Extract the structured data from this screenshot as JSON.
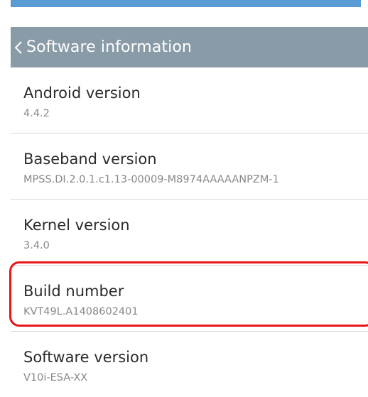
{
  "header": {
    "title": "Software information"
  },
  "items": [
    {
      "label": "Android version",
      "value": "4.4.2"
    },
    {
      "label": "Baseband version",
      "value": "MPSS.DI.2.0.1.c1.13-00009-M8974AAAAANPZM-1"
    },
    {
      "label": "Kernel version",
      "value": "3.4.0"
    },
    {
      "label": "Build number",
      "value": "KVT49L.A1408602401"
    },
    {
      "label": "Software version",
      "value": "V10i-ESA-XX"
    }
  ],
  "colors": {
    "header_bg": "#8a9ba8",
    "top_bar": "#5b9bd5",
    "highlight": "#e8161b",
    "label": "#2b2b2b",
    "value": "#888888"
  },
  "icons": {
    "back": "chevron-left-icon"
  }
}
